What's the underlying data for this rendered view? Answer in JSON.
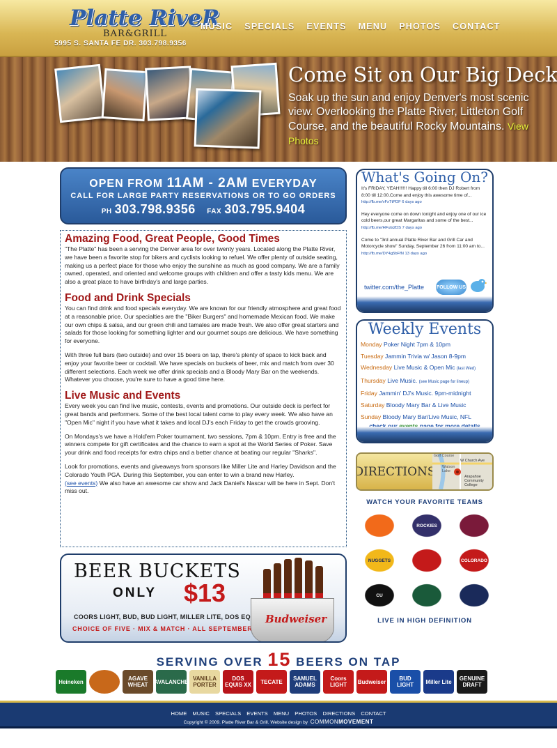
{
  "header": {
    "logo_line1": "Platte RiveR",
    "logo_line2": "BAR&GRILL",
    "address": "5995 S. SANTA FE DR.   303.798.9356",
    "nav": [
      "MUSIC",
      "SPECIALS",
      "EVENTS",
      "MENU",
      "PHOTOS",
      "CONTACT"
    ]
  },
  "hero": {
    "title": "Come Sit on Our Big Deck",
    "text": "Soak up the sun and enjoy Denver's most scenic view. Overlooking the Platte River, Littleton Golf Course, and the beautiful Rocky Mountains.",
    "link": "View Photos"
  },
  "hours": {
    "line1_a": "OPEN FROM ",
    "line1_b": "11AM - 2AM",
    "line1_c": " EVERYDAY",
    "line2": "CALL FOR LARGE PARTY RESERVATIONS OR TO GO ORDERS",
    "ph_label": "PH",
    "phone": "303.798.9356",
    "fax_label": "FAX",
    "fax": "303.795.9404"
  },
  "content": {
    "h1": "Amazing Food, Great People, Good Times",
    "p1": "\"The Platte\" has been a serving the Denver area for over twenty years. Located along the Platte River, we have been a favorite stop for bikers and cyclists looking to refuel. We offer plenty of outside seating, making us a perfect place for those who enjoy the sunshine as much as good company. We are a family owned, operated, and oriented and welcome groups with children and offer a tasty kids menu. We are also a great place to have birthday's and large parties.",
    "h2": "Food and Drink Specials",
    "p2": "You can find drink and food specials everyday. We are known for our friendly atmosphere and great food at a reasonable price. Our specialties are the \"Biker Burgers\" and homemade Mexican food. We make our own chips & salsa, and our green chili and tamales are made fresh. We also offer great starters and salads for those looking for something lighter and our gourmet soups are delicious. We have something for everyone.",
    "p3": "With three full bars (two outside) and over 15 beers on tap, there's plenty of space to kick back and enjoy your favorite beer or cocktail. We have specials on buckets of beer, mix and match from over 30 different selections. Each week we offer drink specials and a Bloody Mary Bar on the weekends. Whatever you choose, you're sure to have a good time here.",
    "h3": "Live Music and Events",
    "p4": "Every week you can find live music, contests, events and promotions. Our outside deck is perfect for great bands and performers. Some of the best local talent come to play every week. We also have an \"Open Mic\" night if you have what it takes and local DJ's each Friday to get the crowds grooving.",
    "p5": "On Mondays's we have a Hold'em Poker tournament, two sessions, 7pm & 10pm. Entry is free and the winners compete for gift certificates and the chance to earn a spot at the World Series of Poker. Save your drink and food receipts for extra chips and a better chance at beating our regular \"Sharks\".",
    "p6a": "Look for promotions, events and giveaways from sponsors like Miller Lite and Harley Davidson and the Colorado Youth PGA. During this September, you can enter to win a brand new Harley.",
    "p6link": "(see events)",
    "p6b": " We also have an awesome car show and Jack Daniel's Nascar will be here in Sept. Don't miss out."
  },
  "beer_buckets": {
    "title": "BEER BUCKETS",
    "only": "ONLY",
    "price": "$13",
    "list": "COORS LIGHT, BUD, BUD LIGHT, MILLER LITE, DOS EQUIS",
    "choice": "CHOICE OF FIVE · MIX & MATCH · ALL SEPTEMBER",
    "bucket_brand": "Budweiser"
  },
  "serving": {
    "a": "SERVING OVER ",
    "b": "15",
    "c": " BEERS ON TAP"
  },
  "brands": [
    {
      "name": "Heineken",
      "color": "#1a7a2a"
    },
    {
      "name": "",
      "color": "#c8681a"
    },
    {
      "name": "AGAVE WHEAT",
      "color": "#6a4a2a"
    },
    {
      "name": "AVALANCHE",
      "color": "#2a6a4a"
    },
    {
      "name": "VANILLA PORTER",
      "color": "#e8d8a0"
    },
    {
      "name": "DOS EQUIS XX",
      "color": "#b8141a"
    },
    {
      "name": "TECATE",
      "color": "#c41a1a"
    },
    {
      "name": "SAMUEL ADAMS",
      "color": "#1f3d7a"
    },
    {
      "name": "Coors LIGHT",
      "color": "#c41a1a"
    },
    {
      "name": "Budweiser",
      "color": "#c41a1a"
    },
    {
      "name": "BUD LIGHT",
      "color": "#1a4fa8"
    },
    {
      "name": "Miller Lite",
      "color": "#1a3a8a"
    },
    {
      "name": "GENUINE DRAFT",
      "color": "#1a1a1a"
    }
  ],
  "twitter": {
    "title": "What's Going On?",
    "tweets": [
      {
        "text": "It's FRIDAY, YEAH!!!!!! Happy till 6:00 then DJ Robert from 8:00 till 12:00.Come and enjoy this awesome time of...",
        "link": "http://fb.me/vFxTtPDF 6 days ago"
      },
      {
        "text": "Hey everyone come on down tonight and enjoy one of our ice cold beers,our great Margaritas and some of the best...",
        "link": "http://fb.me/HFuls2DS 7 days ago"
      },
      {
        "text": "Come to \"3rd annual Platte River Bar and Grill Car and Motorcycle show\" Sunday, September 26 from 11:00 am to...",
        "link": "http://fb.me/DY4g5bFfN 13 days ago"
      }
    ],
    "handle": "twitter.com/the_Platte",
    "follow": "FOLLOW US"
  },
  "weekly": {
    "title": "Weekly Events",
    "events": [
      {
        "day": "Monday",
        "text": "Poker Night 7pm & 10pm",
        "note": ""
      },
      {
        "day": "Tuesday",
        "text": "Jammin Trivia w/ Jason 8-9pm",
        "note": ""
      },
      {
        "day": "Wednesday",
        "text": "Live Music & Open Mic",
        "note": "(last Wed)"
      },
      {
        "day": "Thursday",
        "text": "Live Music.",
        "note": "(see Music page for lineup)"
      },
      {
        "day": "Friday",
        "text": "Jammin' DJ's Music. 9pm-midnight",
        "note": ""
      },
      {
        "day": "Saturday",
        "text": "Bloody Mary Bar & Live Music",
        "note": ""
      },
      {
        "day": "Sunday",
        "text": "Bloody Mary Bar/Live Music, NFL",
        "note": ""
      }
    ],
    "more_a": "check our ",
    "more_b": "events",
    "more_c": " page for more details"
  },
  "directions": {
    "label": "DIRECTIONS",
    "map_labels": [
      "Golf Course",
      "Watson Lake",
      "W Church Ave",
      "Arapahoe Community College"
    ]
  },
  "teams": {
    "watch": "WATCH YOUR FAVORITE TEAMS",
    "list": [
      {
        "name": "",
        "color": "#f26a1a"
      },
      {
        "name": "ROCKIES",
        "color": "#33306a"
      },
      {
        "name": "",
        "color": "#7a1a3a"
      },
      {
        "name": "NUGGETS",
        "color": "#f2b81a"
      },
      {
        "name": "",
        "color": "#c41a1a"
      },
      {
        "name": "COLORADO",
        "color": "#c41a1a"
      },
      {
        "name": "CU",
        "color": "#111111"
      },
      {
        "name": "",
        "color": "#1a5a3a"
      },
      {
        "name": "",
        "color": "#1a2a5a"
      }
    ],
    "live": "LIVE IN HIGH DEFINITION"
  },
  "footer": {
    "nav": [
      "HOME",
      "MUSIC",
      "SPECIALS",
      "EVENTS",
      "MENU",
      "PHOTOS",
      "DIRECTIONS",
      "CONTACT"
    ],
    "copy": "Copyright © 2009. Platte River Bar & Grill. Website design by",
    "designer_a": "COMMON",
    "designer_b": "MOVEMENT"
  }
}
